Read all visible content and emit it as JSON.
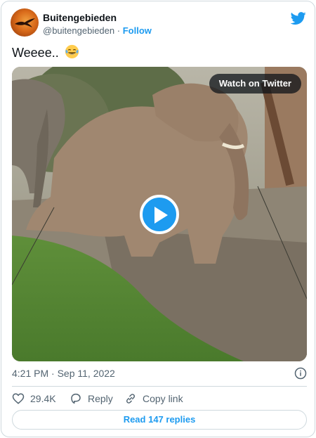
{
  "author": {
    "name": "Buitengebieden",
    "handle": "@buitengebieden",
    "separator": "·",
    "follow_label": "Follow"
  },
  "tweet": {
    "text": "Weeee..",
    "emoji": "face-with-tears-of-joy"
  },
  "media": {
    "watch_label": "Watch on Twitter",
    "type": "video"
  },
  "meta": {
    "timestamp": "4:21 PM · Sep 11, 2022"
  },
  "actions": {
    "likes": "29.4K",
    "reply_label": "Reply",
    "copy_link_label": "Copy link"
  },
  "read_replies_label": "Read 147 replies",
  "colors": {
    "accent": "#1d9bf0",
    "text_primary": "#0f1419",
    "text_secondary": "#536471",
    "border": "#cfd9de"
  }
}
